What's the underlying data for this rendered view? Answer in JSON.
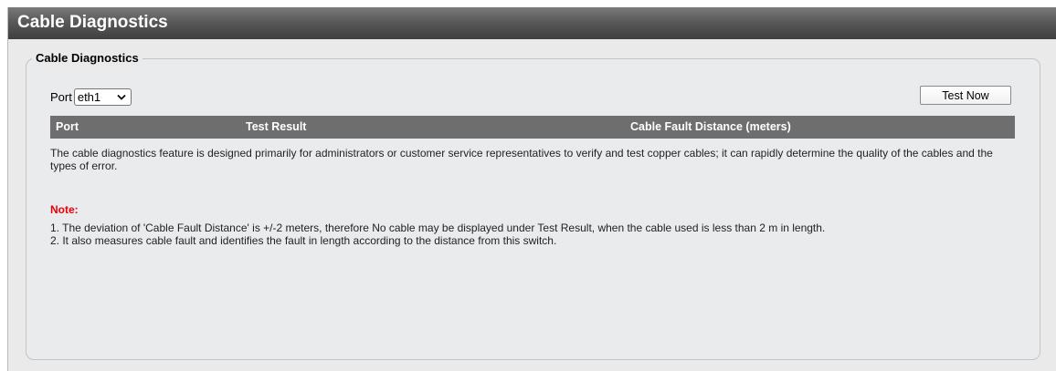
{
  "header": {
    "title": "Cable Diagnostics"
  },
  "panel": {
    "legend": "Cable Diagnostics",
    "port_label": "Port",
    "port_selected": "eth1",
    "test_button_label": "Test Now"
  },
  "table": {
    "columns": [
      "Port",
      "Test Result",
      "Cable Fault Distance (meters)"
    ]
  },
  "description": "The cable diagnostics feature is designed primarily for administrators or customer service representatives to verify and test copper cables; it can rapidly determine the quality of the cables and the types of error.",
  "note": {
    "label": "Note:",
    "lines": [
      "1. The deviation of 'Cable Fault Distance' is +/-2 meters, therefore No cable may be displayed under Test Result, when the cable used is less than 2 m in length.",
      "2. It also measures cable fault and identifies the fault in length according to the distance from this switch."
    ]
  },
  "colors": {
    "title_bar": "#595959",
    "table_header": "#6e6e6e",
    "note_label": "#e8000b"
  }
}
